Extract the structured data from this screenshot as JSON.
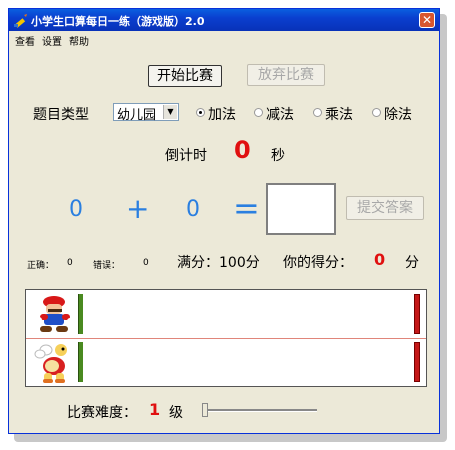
{
  "window": {
    "title": "小学生口算每日一练（游戏版）2.0",
    "close_symbol": "✕"
  },
  "menu": [
    "查看",
    "设置",
    "帮助"
  ],
  "buttons": {
    "start": "开始比赛",
    "abandon": "放弃比赛",
    "submit": "提交答案"
  },
  "question_type": {
    "label": "题目类型",
    "selected": "幼儿园",
    "operations": [
      {
        "label": "加法",
        "selected": true
      },
      {
        "label": "减法",
        "selected": false
      },
      {
        "label": "乘法",
        "selected": false
      },
      {
        "label": "除法",
        "selected": false
      }
    ]
  },
  "countdown": {
    "label": "倒计时",
    "value": "0",
    "unit": "秒"
  },
  "problem": {
    "left": "0",
    "operator": "+",
    "right": "0",
    "equals": "=",
    "answer": ""
  },
  "stats": {
    "correct_label": "正确：",
    "correct_value": "0",
    "wrong_label": "错误：",
    "wrong_value": "0",
    "full_score": "满分：100分",
    "your_score_label": "你的得分：",
    "your_score_value": "0",
    "score_unit": "分"
  },
  "race": {
    "player": "mario-icon",
    "opponent": "koopa-icon"
  },
  "difficulty": {
    "label": "比赛难度：",
    "value": "1",
    "unit": "级",
    "slider_fraction": 0
  },
  "colors": {
    "accent_red": "#e01010",
    "digit_blue": "#2a7fe0",
    "titlebar": "#0a3fcf"
  }
}
